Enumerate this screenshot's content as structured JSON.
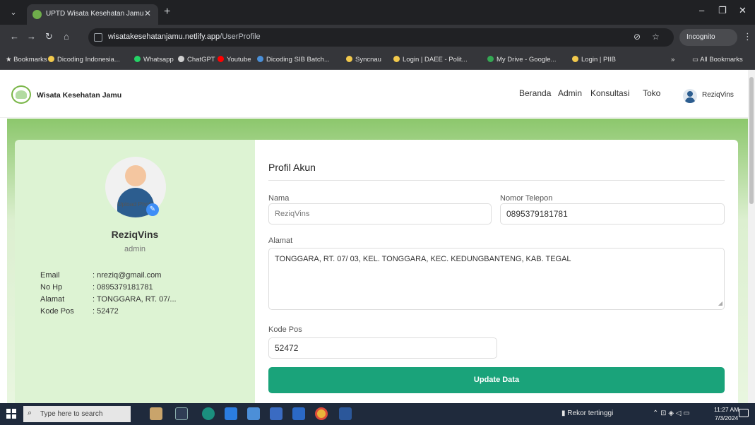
{
  "browser": {
    "tab_title": "UPTD Wisata Kesehatan Jamu",
    "url_host": "wisatakesehatanjamu.netlify.app",
    "url_path": "/UserProfile",
    "incognito_label": "Incognito",
    "bookmarks": [
      {
        "label": "Bookmarks",
        "color": "#e0e0e0"
      },
      {
        "label": "Dicoding Indonesia...",
        "color": "#f2c94c"
      },
      {
        "label": "Whatsapp",
        "color": "#25d366"
      },
      {
        "label": "ChatGPT",
        "color": "#cfcfcf"
      },
      {
        "label": "Youtube",
        "color": "#ff0000"
      },
      {
        "label": "Dicoding SIB Batch...",
        "color": "#4a90d9"
      },
      {
        "label": "Syncnau",
        "color": "#f2c94c"
      },
      {
        "label": "Login | DAEE - Polit...",
        "color": "#f2c94c"
      },
      {
        "label": "My Drive - Google...",
        "color": "#34a853"
      },
      {
        "label": "Login | PIIB",
        "color": "#f2c94c"
      }
    ],
    "all_bookmarks": "All Bookmarks"
  },
  "site": {
    "brand": "Wisata Kesehatan Jamu",
    "nav": [
      "Beranda",
      "Admin",
      "Konsultasi",
      "Toko"
    ],
    "user_name": "ReziqVins"
  },
  "profile_card": {
    "upload_label": "Upload Photo",
    "name": "ReziqVins",
    "role": "admin",
    "info": [
      {
        "key": "Email",
        "value": ": nreziq@gmail.com"
      },
      {
        "key": "No Hp",
        "value": ": 0895379181781"
      },
      {
        "key": "Alamat",
        "value": ": TONGGARA, RT. 07/..."
      },
      {
        "key": "Kode Pos",
        "value": ": 52472"
      }
    ]
  },
  "form": {
    "title": "Profil Akun",
    "name_label": "Nama",
    "name_value": "ReziqVins",
    "phone_label": "Nomor Telepon",
    "phone_value": "0895379181781",
    "address_label": "Alamat",
    "address_value": "TONGGARA, RT. 07/ 03, KEL. TONGGARA, KEC. KEDUNGBANTENG, KAB. TEGAL",
    "postal_label": "Kode Pos",
    "postal_value": "52472",
    "submit_label": "Update Data"
  },
  "taskbar": {
    "search_placeholder": "Type here to search",
    "tray_text": "Rekor tertinggi",
    "time": "11:27 AM",
    "date": "7/3/2024"
  },
  "colors": {
    "accent_green": "#1aa37a",
    "banner_green": "#8cc76c",
    "left_card_bg": "#ddf3d3"
  }
}
